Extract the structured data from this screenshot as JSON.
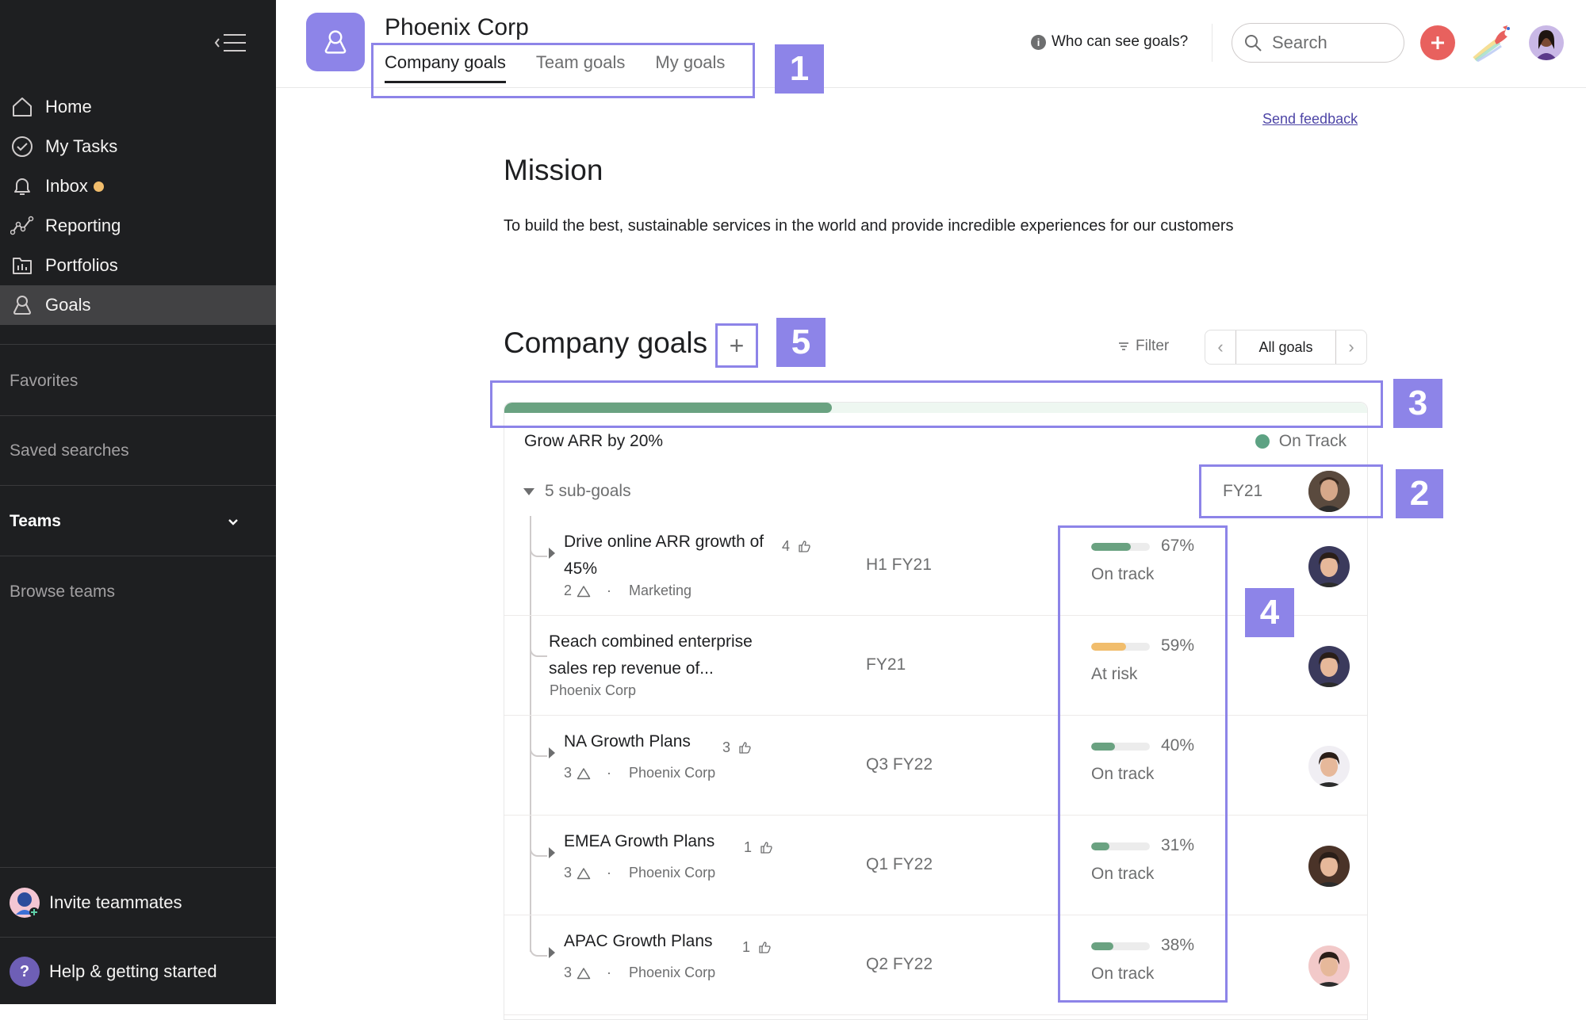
{
  "sidebar": {
    "nav": [
      {
        "label": "Home",
        "icon": "home-icon"
      },
      {
        "label": "My Tasks",
        "icon": "check-circle-icon"
      },
      {
        "label": "Inbox",
        "icon": "bell-icon",
        "unread_dot": true
      },
      {
        "label": "Reporting",
        "icon": "reporting-icon"
      },
      {
        "label": "Portfolios",
        "icon": "portfolio-icon"
      },
      {
        "label": "Goals",
        "icon": "goals-icon",
        "active": true
      }
    ],
    "favorites": "Favorites",
    "saved_searches": "Saved searches",
    "teams": "Teams",
    "browse_teams": "Browse teams",
    "invite": "Invite teammates",
    "help": "Help & getting started",
    "help_glyph": "?"
  },
  "header": {
    "title": "Phoenix Corp",
    "tabs": [
      {
        "label": "Company goals",
        "active": true
      },
      {
        "label": "Team goals"
      },
      {
        "label": "My goals"
      }
    ],
    "who_can_see": "Who can see goals?",
    "info_glyph": "i",
    "search_placeholder": "Search"
  },
  "main": {
    "send_feedback": "Send feedback",
    "mission_title": "Mission",
    "mission_text": "To build the best, sustainable services in the world and provide incredible experiences for our customers",
    "goals_title": "Company goals",
    "add_glyph": "+",
    "filter": "Filter",
    "pager_label": "All goals",
    "pager_prev": "‹",
    "pager_next": "›",
    "goal": {
      "name": "Grow ARR by 20%",
      "status": "On Track",
      "progress": 0.38,
      "subgoals_label": "5 sub-goals",
      "period": "FY21",
      "colors": {
        "on_track": "#6aa281",
        "at_risk": "#f1bd6c"
      }
    },
    "subgoals": [
      {
        "title": "Drive online ARR growth of 45%",
        "likes": "4",
        "warnings": "2",
        "owner_team": "Marketing",
        "period": "H1 FY21",
        "percent": 67,
        "percent_label": "67%",
        "status": "On track",
        "status_key": "on_track",
        "has_children": true,
        "avatar": "#3b3a5c"
      },
      {
        "title": "Reach combined enterprise sales rep revenue of...",
        "likes": "",
        "warnings": "",
        "owner_team": "Phoenix Corp",
        "period": "FY21",
        "percent": 59,
        "percent_label": "59%",
        "status": "At risk",
        "status_key": "at_risk",
        "has_children": false,
        "avatar": "#3b3a5c"
      },
      {
        "title": "NA Growth Plans",
        "likes": "3",
        "warnings": "3",
        "owner_team": "Phoenix Corp",
        "period": "Q3 FY22",
        "percent": 40,
        "percent_label": "40%",
        "status": "On track",
        "status_key": "on_track",
        "has_children": true,
        "avatar": "#f0eef3"
      },
      {
        "title": "EMEA Growth Plans",
        "likes": "1",
        "warnings": "3",
        "owner_team": "Phoenix Corp",
        "period": "Q1 FY22",
        "percent": 31,
        "percent_label": "31%",
        "status": "On track",
        "status_key": "on_track",
        "has_children": true,
        "avatar": "#4a3328"
      },
      {
        "title": "APAC Growth Plans",
        "likes": "1",
        "warnings": "3",
        "owner_team": "Phoenix Corp",
        "period": "Q2 FY22",
        "percent": 38,
        "percent_label": "38%",
        "status": "On track",
        "status_key": "on_track",
        "has_children": true,
        "avatar": "#f2c9c9"
      }
    ]
  },
  "annotations": [
    "1",
    "2",
    "3",
    "4",
    "5"
  ]
}
